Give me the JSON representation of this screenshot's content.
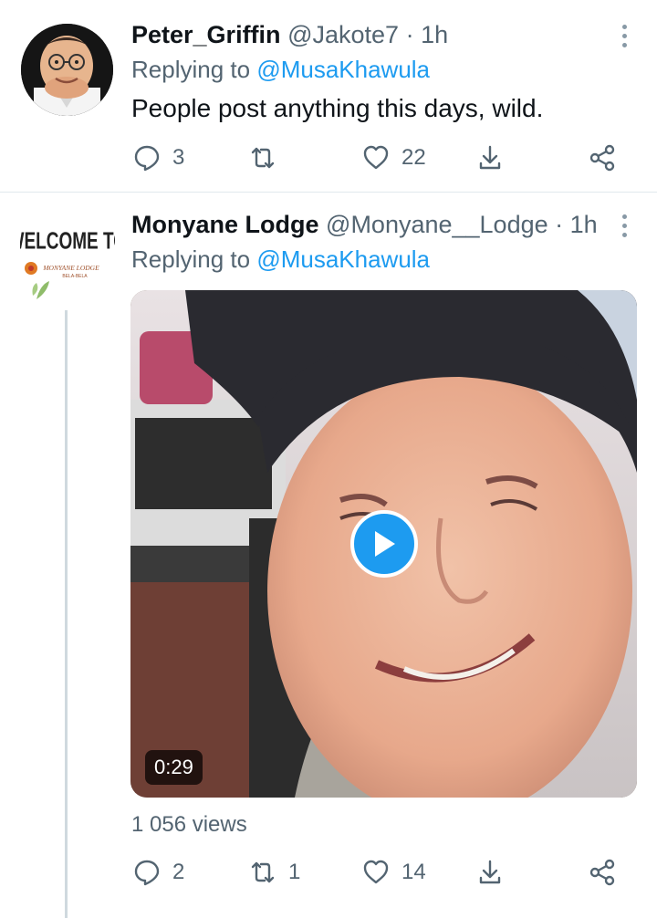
{
  "tweets": [
    {
      "author_name": "Peter_Griffin",
      "author_handle": "@Jakote7",
      "separator": "·",
      "time": "1h",
      "replying_prefix": "Replying to",
      "replying_to": "@MusaKhawula",
      "text": "People post anything this days, wild.",
      "replies": "3",
      "retweets": "",
      "likes": "22"
    },
    {
      "author_name": "Monyane Lodge",
      "author_handle": "@Monyane__Lodge",
      "separator": "·",
      "time": "1h",
      "replying_prefix": "Replying to",
      "replying_to": "@MusaKhawula",
      "avatar_text": {
        "welcome": "WELCOME TO",
        "lodge": "MONYANE LODGE",
        "place": "BELA-BELA"
      },
      "video_duration": "0:29",
      "views": "1 056 views",
      "replies": "2",
      "retweets": "1",
      "likes": "14"
    }
  ],
  "colors": {
    "accent": "#1d9bf0",
    "secondary_text": "#536471",
    "divider": "#e1e8ed",
    "thread_line": "#cfd9de"
  },
  "icons": [
    "comment-icon",
    "retweet-icon",
    "heart-icon",
    "share-icon",
    "network-share-icon",
    "more-icon",
    "play-icon"
  ]
}
